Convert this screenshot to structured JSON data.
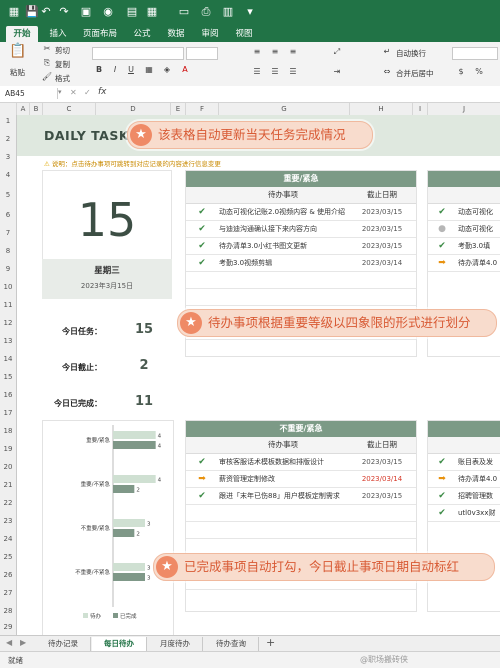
{
  "ribbon": {
    "tabs": [
      "开始",
      "插入",
      "页面布局",
      "公式",
      "数据",
      "审阅",
      "视图"
    ],
    "paste": "粘贴",
    "cut": "剪切",
    "copy": "复制",
    "format_painter": "格式",
    "wrap_text": "自动换行",
    "merge_center": "合并后居中",
    "currency_symbol": "$"
  },
  "formula_bar": {
    "cell_ref": "AB45",
    "fx": "fx"
  },
  "columns": [
    "A",
    "B",
    "C",
    "D",
    "E",
    "F",
    "G",
    "H",
    "I",
    "J"
  ],
  "rows": [
    "1",
    "2",
    "3",
    "4",
    "5",
    "6",
    "7",
    "8",
    "9",
    "10",
    "11",
    "12",
    "13",
    "14",
    "15",
    "16",
    "17",
    "18",
    "19",
    "20",
    "21",
    "22",
    "23",
    "24",
    "25",
    "26",
    "27",
    "28",
    "29"
  ],
  "dashboard": {
    "title": "DAILY TASK",
    "note": "说明：点击待办事项可跳转到对应记录的内容进行信息变更",
    "callout1": "该表格自动更新当天任务完成情况",
    "callout2": "待办事项根据重要等级以四象限的形式进行划分",
    "callout3": "已完成事项自动打勾，今日截止事项日期自动标红",
    "day_number": "15",
    "weekday": "星期三",
    "full_date": "2023年3月15日",
    "stats": [
      {
        "label": "今日任务：",
        "value": "15"
      },
      {
        "label": "今日截止：",
        "value": "2"
      },
      {
        "label": "今日已完成：",
        "value": "11"
      }
    ]
  },
  "panels": {
    "urgent_important": {
      "title": "重要/紧急",
      "col_task": "待办事项",
      "col_date": "截止日期",
      "rows": [
        {
          "status": "✔",
          "task": "动态可视化记账2.0视频内容 & 使用介绍",
          "date": "2023/03/15"
        },
        {
          "status": "✔",
          "task": "与迪迪沟通确认接下来内容方向",
          "date": "2023/03/15"
        },
        {
          "status": "✔",
          "task": "待办清单3.0小红书图文更新",
          "date": "2023/03/15"
        },
        {
          "status": "✔",
          "task": "考勤3.0视频剪辑",
          "date": "2023/03/14"
        }
      ]
    },
    "right_top": {
      "rows": [
        {
          "status": "✔",
          "task": "动态可视化"
        },
        {
          "status": "●",
          "task": "动态可视化"
        },
        {
          "status": "✔",
          "task": "考勤3.0填"
        },
        {
          "status": "➡",
          "task": "待办清单4.0"
        }
      ]
    },
    "not_important_urgent": {
      "title": "不重要/紧急",
      "col_task": "待办事项",
      "col_date": "截止日期",
      "rows": [
        {
          "status": "✔",
          "task": "审核客服话术模板数据和排版设计",
          "date": "2023/03/15",
          "red": false
        },
        {
          "status": "➡",
          "task": "薪资管理定制修改",
          "date": "2023/03/14",
          "red": true
        },
        {
          "status": "✔",
          "task": "跟进「末年已伤88」用户模板定制需求",
          "date": "2023/03/15",
          "red": false
        }
      ]
    },
    "right_bottom": {
      "rows": [
        {
          "status": "✔",
          "task": "账目表及发"
        },
        {
          "status": "➡",
          "task": "待办清单4.0"
        },
        {
          "status": "✔",
          "task": "招聘管理数"
        },
        {
          "status": "✔",
          "task": "utl0v3xx财"
        }
      ]
    }
  },
  "chart_data": {
    "type": "bar",
    "orientation": "horizontal",
    "categories": [
      "重要/紧急",
      "重要/不紧急",
      "不重要/紧急",
      "不重要/不紧急"
    ],
    "series": [
      {
        "name": "待办",
        "values": [
          4,
          4,
          3,
          3
        ],
        "color": "#cfe0d2"
      },
      {
        "name": "已完成",
        "values": [
          4,
          2,
          2,
          3
        ],
        "color": "#7f9888"
      }
    ],
    "xlim": [
      0,
      4.5
    ],
    "legend": "bottom"
  },
  "sheet_tabs": [
    "待办记录",
    "每日待办",
    "月度待办",
    "待办查询"
  ],
  "active_sheet": "每日待办",
  "status": "就绪",
  "watermark": "@职场搬砖侠"
}
